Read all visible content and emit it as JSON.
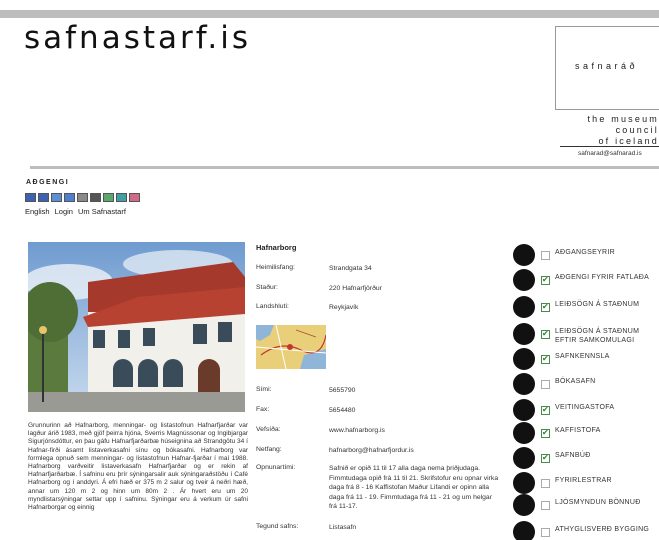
{
  "site": {
    "logo": "safnastarf.is"
  },
  "council": {
    "brand": "safnaráð",
    "lines": [
      "the museum",
      "council",
      "of iceland"
    ],
    "email": "safnarad@safnarad.is"
  },
  "accessibility": {
    "title": "AÐGENGI",
    "buttons": [
      {
        "name": "text-size-a1-button",
        "color": "#3b63b0"
      },
      {
        "name": "text-size-a2-button",
        "color": "#3b63b0"
      },
      {
        "name": "text-size-a3-button",
        "color": "#5b8fd6"
      },
      {
        "name": "contrast-blue-button",
        "color": "#4f7fcf"
      },
      {
        "name": "contrast-gray-button",
        "color": "#8a8a8a"
      },
      {
        "name": "contrast-dark-button",
        "color": "#555555"
      },
      {
        "name": "contrast-green-button",
        "color": "#5aa86b"
      },
      {
        "name": "contrast-teal-button",
        "color": "#3fa0a6"
      },
      {
        "name": "contrast-pink-button",
        "color": "#d16a86"
      }
    ],
    "links": [
      "English",
      "Login",
      "Um Safnastarf"
    ]
  },
  "description": "Grunnurinn að Hafnarborg, menningar- og listastofnun Hafnarfjarðar var lagður árið 1983, með gjöf þeirra hjóna, Sverris Magnússonar og Ingibjargar Sigurjónsdóttur, en þau gáfu Hafnarfjarðarbæ húseignina að Strandgötu 34 í Hafnar-firði ásamt listaverkasafni sínu og bókasafni. Hafnarborg var formlega opnuð sem menningar- og listastofnun Hafnar-fjarðar í maí 1988. Hafnarborg varðveitir listaverkasafn Hafnarfjarðar og er rekin af Hafnarfjarðarbæ. Í safninu eru þrír sýningarsalir auk sýningaraðstöðu í Café Hafnarborg og í anddyri. Á efri hæð er 375 m 2 salur og tveir á neðri hæð, annar um 120 m 2 og hinn um 80m 2 . Ár hvert eru um 20 myndlistarsýningar settar upp í safninu. Sýningar eru á verkum úr safni Hafnarborgar og einnig",
  "museum": {
    "name": "Hafnarborg",
    "rows": [
      {
        "label": "Heimilisfang:",
        "value": "Strandgata 34"
      },
      {
        "label": "Staður:",
        "value": "220 Hafnarfjörður"
      },
      {
        "label": "Landshluti:",
        "value": "Reykjavík"
      },
      {
        "label": "Sími:",
        "value": "5655790"
      },
      {
        "label": "Fax:",
        "value": "5654480"
      },
      {
        "label": "Vefsíða:",
        "value": "www.hafnarborg.is"
      },
      {
        "label": "Netfang:",
        "value": "hafnarborg@hafnarfjordur.is"
      },
      {
        "label": "Opnunartími:",
        "value": "Safnið er opið 11 til 17 alla daga nema þriðjudaga. Fimmtudaga opið frá 11 til 21. Skrifstofur eru opnar virka daga frá 8 - 16 Kaffistofan Maður Lifandi er opinn alla daga frá 11 - 19. Fimmtudaga frá 11 - 21 og um helgar frá 11-17."
      },
      {
        "label": "Tegund safns:",
        "value": "Listasafn"
      }
    ]
  },
  "facilities": [
    {
      "label": "AÐGANGSEYRIR",
      "checked": false,
      "icon": "money-icon"
    },
    {
      "label": "AÐGENGI FYRIR FATLAÐA",
      "checked": true,
      "icon": "wheelchair-icon"
    },
    {
      "label": "LEIÐSÖGN Á STAÐNUM",
      "checked": true,
      "icon": "guide-icon"
    },
    {
      "label": "LEIÐSÖGN Á STAÐNUM EFTIR SAMKOMULAGI",
      "checked": true,
      "icon": "group-guide-icon"
    },
    {
      "label": "SAFNKENNSLA",
      "checked": true,
      "icon": "education-icon"
    },
    {
      "label": "BÓKASAFN",
      "checked": false,
      "icon": "library-icon"
    },
    {
      "label": "VEITINGASTOFA",
      "checked": true,
      "icon": "restaurant-icon"
    },
    {
      "label": "KAFFISTOFA",
      "checked": true,
      "icon": "coffee-icon"
    },
    {
      "label": "SAFNBÚÐ",
      "checked": true,
      "icon": "shop-icon"
    },
    {
      "label": "FYRIRLESTRAR",
      "checked": false,
      "icon": "lecture-icon"
    },
    {
      "label": "LJÓSMYNDUN BÖNNUÐ",
      "checked": false,
      "icon": "no-photo-icon"
    },
    {
      "label": "ATHYGLISVERÐ BYGGING",
      "checked": false,
      "icon": "building-icon"
    }
  ]
}
